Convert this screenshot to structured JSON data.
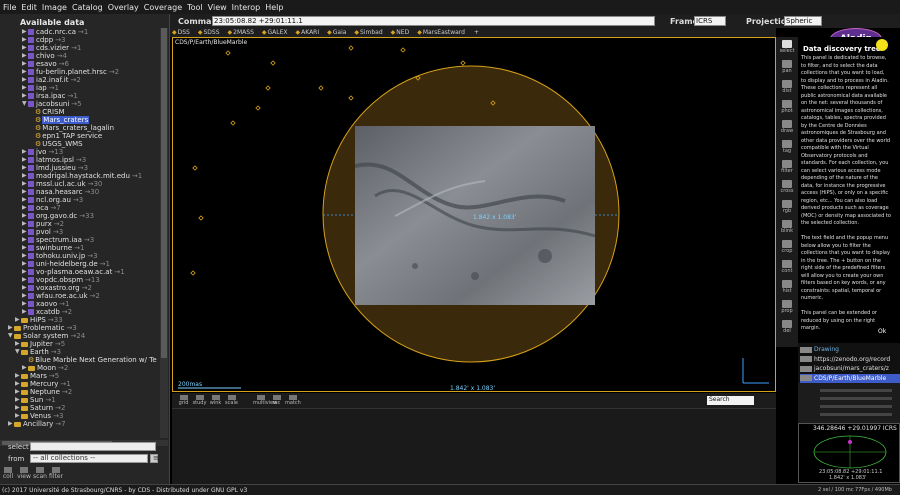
{
  "menu": [
    "File",
    "Edit",
    "Image",
    "Catalog",
    "Overlay",
    "Coverage",
    "Tool",
    "View",
    "Interop",
    "Help"
  ],
  "command": {
    "label": "Command",
    "value": "23:05:08.82 +29:01:11.1"
  },
  "frame": {
    "label": "Frame",
    "value": "ICRS"
  },
  "projection": {
    "label": "Projection",
    "value": "Spheric"
  },
  "logo": "Aladin",
  "hips_shortcuts": [
    "DSS",
    "SDSS",
    "2MASS",
    "GALEX",
    "AKARI",
    "Gaia",
    "Simbad",
    "NED",
    "MarsEastward",
    "+"
  ],
  "tree": {
    "title": "Available data",
    "items": [
      {
        "label": "cadc.nrc.ca",
        "count": "→1",
        "depth": 2,
        "kind": "db"
      },
      {
        "label": "cdpp",
        "count": "→3",
        "depth": 2,
        "kind": "db"
      },
      {
        "label": "cds.vizier",
        "count": "→1",
        "depth": 2,
        "kind": "db"
      },
      {
        "label": "chivo",
        "count": "→4",
        "depth": 2,
        "kind": "db"
      },
      {
        "label": "esavo",
        "count": "→6",
        "depth": 2,
        "kind": "db"
      },
      {
        "label": "fu-berlin.planet.hrsc",
        "count": "→2",
        "depth": 2,
        "kind": "db"
      },
      {
        "label": "ia2.inaf.it",
        "count": "→2",
        "depth": 2,
        "kind": "db"
      },
      {
        "label": "iap",
        "count": "→1",
        "depth": 2,
        "kind": "db"
      },
      {
        "label": "irsa.ipac",
        "count": "→1",
        "depth": 2,
        "kind": "db"
      },
      {
        "label": "jacobsuni",
        "count": "→5",
        "depth": 2,
        "kind": "db",
        "open": true
      },
      {
        "label": "CRISM",
        "count": "",
        "depth": 3,
        "kind": "leaf"
      },
      {
        "label": "Mars_craters",
        "count": "",
        "depth": 3,
        "kind": "leaf",
        "selected": true
      },
      {
        "label": "Mars_craters_lagalin",
        "count": "",
        "depth": 3,
        "kind": "leaf"
      },
      {
        "label": "epn1 TAP service",
        "count": "",
        "depth": 3,
        "kind": "leaf"
      },
      {
        "label": "USGS_WMS",
        "count": "",
        "depth": 3,
        "kind": "leaf"
      },
      {
        "label": "jvo",
        "count": "→13",
        "depth": 2,
        "kind": "db"
      },
      {
        "label": "latmos.ipsl",
        "count": "→3",
        "depth": 2,
        "kind": "db"
      },
      {
        "label": "lmd.jussieu",
        "count": "→3",
        "depth": 2,
        "kind": "db"
      },
      {
        "label": "madrigal.haystack.mit.edu",
        "count": "→1",
        "depth": 2,
        "kind": "db"
      },
      {
        "label": "mssl.ucl.ac.uk",
        "count": "→30",
        "depth": 2,
        "kind": "db"
      },
      {
        "label": "nasa.heasarc",
        "count": "→30",
        "depth": 2,
        "kind": "db"
      },
      {
        "label": "ncl.org.au",
        "count": "→3",
        "depth": 2,
        "kind": "db"
      },
      {
        "label": "oca",
        "count": "→7",
        "depth": 2,
        "kind": "db"
      },
      {
        "label": "org.gavo.dc",
        "count": "→33",
        "depth": 2,
        "kind": "db"
      },
      {
        "label": "purx",
        "count": "→2",
        "depth": 2,
        "kind": "db"
      },
      {
        "label": "pvol",
        "count": "→3",
        "depth": 2,
        "kind": "db"
      },
      {
        "label": "spectrum.iaa",
        "count": "→3",
        "depth": 2,
        "kind": "db"
      },
      {
        "label": "swinburne",
        "count": "→1",
        "depth": 2,
        "kind": "db"
      },
      {
        "label": "tohoku.univ.jp",
        "count": "→3",
        "depth": 2,
        "kind": "db"
      },
      {
        "label": "uni-heidelberg.de",
        "count": "→1",
        "depth": 2,
        "kind": "db"
      },
      {
        "label": "vo-plasma.oeaw.ac.at",
        "count": "→1",
        "depth": 2,
        "kind": "db"
      },
      {
        "label": "vopdc.obspm",
        "count": "→13",
        "depth": 2,
        "kind": "db"
      },
      {
        "label": "voxastro.org",
        "count": "→2",
        "depth": 2,
        "kind": "db"
      },
      {
        "label": "wfau.roe.ac.uk",
        "count": "→2",
        "depth": 2,
        "kind": "db"
      },
      {
        "label": "xaovo",
        "count": "→1",
        "depth": 2,
        "kind": "db"
      },
      {
        "label": "xcatdb",
        "count": "→2",
        "depth": 2,
        "kind": "db"
      },
      {
        "label": "HiPS",
        "count": "→33",
        "depth": 1,
        "kind": "folder"
      },
      {
        "label": "Problematic",
        "count": "→3",
        "depth": 0,
        "kind": "folder"
      },
      {
        "label": "Solar system",
        "count": "→24",
        "depth": 0,
        "kind": "folder",
        "open": true
      },
      {
        "label": "Jupiter",
        "count": "→5",
        "depth": 1,
        "kind": "folder"
      },
      {
        "label": "Earth",
        "count": "→3",
        "depth": 1,
        "kind": "folder",
        "open": true
      },
      {
        "label": "Blue Marble Next Generation w/ Te",
        "count": "",
        "depth": 2,
        "kind": "leaf"
      },
      {
        "label": "Moon",
        "count": "→2",
        "depth": 2,
        "kind": "folder"
      },
      {
        "label": "Mars",
        "count": "→5",
        "depth": 1,
        "kind": "folder"
      },
      {
        "label": "Mercury",
        "count": "→1",
        "depth": 1,
        "kind": "folder"
      },
      {
        "label": "Neptune",
        "count": "→2",
        "depth": 1,
        "kind": "folder"
      },
      {
        "label": "Sun",
        "count": "→1",
        "depth": 1,
        "kind": "folder"
      },
      {
        "label": "Saturn",
        "count": "→2",
        "depth": 1,
        "kind": "folder"
      },
      {
        "label": "Venus",
        "count": "→3",
        "depth": 1,
        "kind": "folder"
      },
      {
        "label": "Ancillary",
        "count": "→7",
        "depth": 0,
        "kind": "folder"
      }
    ]
  },
  "filter": {
    "select_label": "select",
    "select_value": "",
    "from_label": "from",
    "from_value": "-- all collections --"
  },
  "left_bottom_icons": [
    "coll",
    "view",
    "scan",
    "filter"
  ],
  "view": {
    "survey_label": "CDS/P/Earth/BlueMarble",
    "scale": "200mas",
    "size": "1.842' x 1.083'",
    "center": "1.842 x 1.083'",
    "colors": {
      "accent": "#d6a11a",
      "overlay": "#7ad0ff"
    }
  },
  "tools": [
    "select",
    "pan",
    "dist",
    "phot",
    "draw",
    "tag",
    "filter",
    "cross",
    "rgb",
    "blink",
    "crop",
    "cont",
    "hist",
    "prop",
    "del"
  ],
  "info": {
    "title": "Data discovery tree",
    "text": "This panel is dedicated to browse,\nto filter, and to select the data\ncollections that you want to load,\nto display and to process in Aladin.\nThese collections represent all\npublic astronomical data available\non the net: several thousands of\nastronomical images collections,\ncatalogs, tables, spectra provided\nby the Centre de Données\nastronomiques de Strasbourg and\nother data providers over the world\ncompatible with the Virtual\nObservatory protocols and\nstandards. For each collection, you\ncan select various access mode\ndepending of the nature of the\ndata, for instance the progressive\naccess (HiPS), or only on a specific\nregion, etc... You can also load\nderived products such as coverage\n(MOC) or density map associated to\nthe selected collection.\n\nThe text field and the popup menu\nbelow allow you to filter the\ncollections that you want to display\nin the tree. The + button on the\nright side of the predefined filters\nwill allow you to create your own\nfilters based on key words, or any\nconstraints: spatial, temporal or\nnumeric.\n\nThis panel can be extended or\nreduced by using on the right\nmargin.",
    "ok": "Ok"
  },
  "stack": [
    {
      "label": "Drawing",
      "color": "#6fb6e8"
    },
    {
      "label": "https://zenodo.org/record",
      "color": "#e0e0e0"
    },
    {
      "label": "jacobsuni/mars_craters/z",
      "color": "#e0e0e0"
    },
    {
      "label": "CDS/P/Earth/BlueMarble",
      "color": "#ffffff",
      "selected": true
    }
  ],
  "below_view": {
    "tools": [
      "grid",
      "study",
      "wink",
      "scale",
      "multiview",
      "rec",
      "match"
    ],
    "search_placeholder": "Search"
  },
  "minimap": {
    "coord": "346.28646 +29.01997 ICRS",
    "coord2": "23:05:08.82 +29:01:11.1",
    "size": "1.842' x 1.083'"
  },
  "status": {
    "copyright": "(c) 2017 Université de Strasbourg/CNRS - by CDS - Distributed under GNU GPL v3",
    "memory": "2 sel / 100 mc   77Fps / 490Mb"
  }
}
